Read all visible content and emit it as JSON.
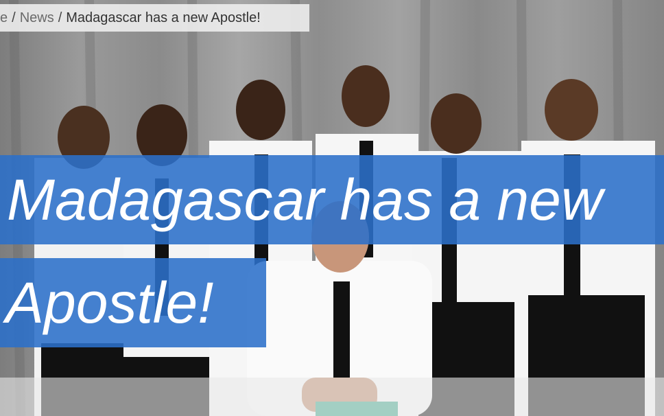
{
  "breadcrumb": {
    "home": "e",
    "news": "News",
    "current": "Madagascar has a new Apostle!"
  },
  "headline": {
    "line1": "Madagascar has a new",
    "line2": "Apostle!"
  },
  "colors": {
    "band": "#2b6fc9",
    "text": "#ffffff"
  }
}
